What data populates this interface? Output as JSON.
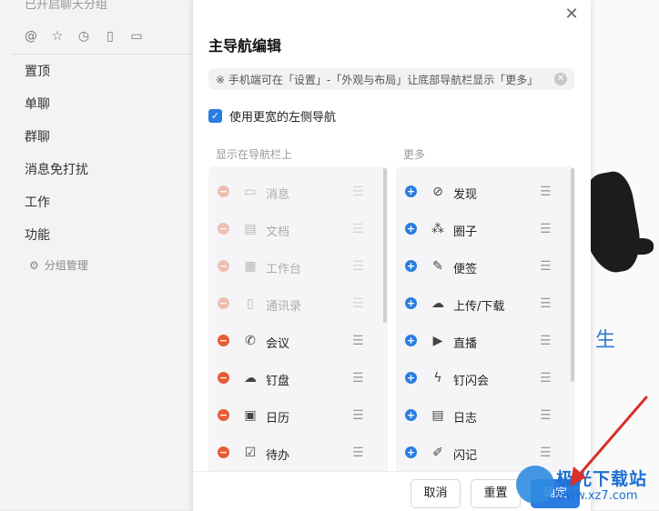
{
  "sidebar": {
    "top_text": "已开启聊天分组",
    "icons": [
      "at-icon",
      "star-icon",
      "clock-icon",
      "file-icon",
      "doc-icon"
    ],
    "items": [
      "置顶",
      "单聊",
      "群聊",
      "消息免打扰",
      "工作",
      "功能"
    ],
    "manage_label": "分组管理"
  },
  "background": {
    "side_text": "生"
  },
  "dialog": {
    "title": "主导航编辑",
    "tip": "※ 手机端可在「设置」-「外观与布局」让底部导航栏显示「更多」",
    "checkbox_label": "使用更宽的左侧导航",
    "left_header": "显示在导航栏上",
    "right_header": "更多",
    "left_items": [
      {
        "label": "消息",
        "icon": "message-icon",
        "disabled": true
      },
      {
        "label": "文档",
        "icon": "document-icon",
        "disabled": true
      },
      {
        "label": "工作台",
        "icon": "workbench-icon",
        "disabled": true
      },
      {
        "label": "通讯录",
        "icon": "contacts-icon",
        "disabled": true
      },
      {
        "label": "会议",
        "icon": "meeting-icon",
        "disabled": false
      },
      {
        "label": "钉盘",
        "icon": "cloud-drive-icon",
        "disabled": false
      },
      {
        "label": "日历",
        "icon": "calendar-icon",
        "disabled": false
      },
      {
        "label": "待办",
        "icon": "todo-icon",
        "disabled": false
      }
    ],
    "right_items": [
      {
        "label": "发现",
        "icon": "compass-icon"
      },
      {
        "label": "圈子",
        "icon": "circle-icon"
      },
      {
        "label": "便签",
        "icon": "note-icon"
      },
      {
        "label": "上传/下载",
        "icon": "upload-download-icon"
      },
      {
        "label": "直播",
        "icon": "live-icon"
      },
      {
        "label": "钉闪会",
        "icon": "flash-meeting-icon"
      },
      {
        "label": "日志",
        "icon": "log-icon"
      },
      {
        "label": "闪记",
        "icon": "flash-note-icon"
      }
    ],
    "buttons": {
      "cancel": "取消",
      "reset": "重置",
      "confirm": "确定"
    }
  },
  "watermark": {
    "text": "极光下载站",
    "url": "www.xz7.com"
  },
  "colors": {
    "accent": "#2a7de1",
    "remove": "#e95b32",
    "arrow": "#d9302a"
  }
}
